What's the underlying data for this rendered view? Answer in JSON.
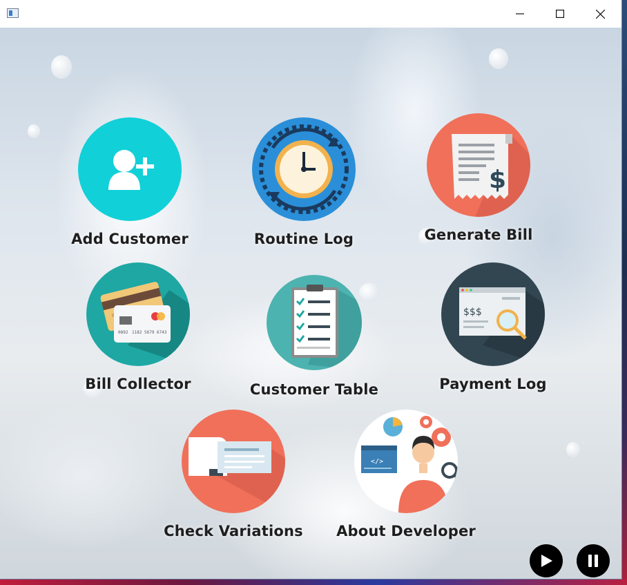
{
  "window": {
    "title": "",
    "controls": {
      "minimize": "minimize",
      "maximize": "maximize",
      "close": "close"
    }
  },
  "menu": {
    "tiles": [
      {
        "id": "add-customer",
        "label": "Add Customer",
        "icon": "add-user-icon",
        "color": "#12d0d8"
      },
      {
        "id": "routine-log",
        "label": "Routine Log",
        "icon": "clock-cycle-icon",
        "color": "#2a8fd8"
      },
      {
        "id": "generate-bill",
        "label": "Generate Bill",
        "icon": "receipt-dollar-icon",
        "color": "#f0705a"
      },
      {
        "id": "bill-collector",
        "label": "Bill Collector",
        "icon": "credit-card-icon",
        "color": "#1fa7a3"
      },
      {
        "id": "customer-table",
        "label": "Customer Table",
        "icon": "clipboard-checklist-icon",
        "color": "#4db3b0"
      },
      {
        "id": "payment-log",
        "label": "Payment Log",
        "icon": "browser-search-icon",
        "color": "#324652"
      },
      {
        "id": "check-variations",
        "label": "Check  Variations",
        "icon": "document-cards-icon",
        "color": "#f0705a"
      },
      {
        "id": "about-developer",
        "label": "About Developer",
        "icon": "developer-icon",
        "color": "#ffffff"
      }
    ],
    "card_numbers": [
      "0892",
      "1182",
      "5679",
      "6743"
    ],
    "price_text": "$$$",
    "dollar_sign": "$"
  },
  "media": {
    "play": "play",
    "pause": "pause"
  }
}
